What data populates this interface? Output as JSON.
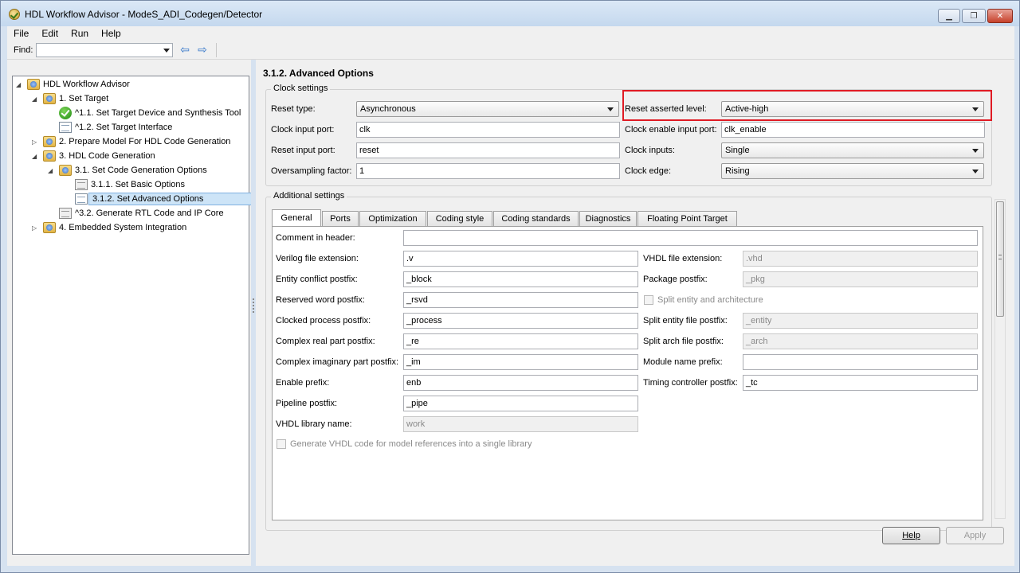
{
  "window": {
    "title": "HDL Workflow Advisor - ModeS_ADI_Codegen/Detector",
    "minimize": "▁",
    "maximize": "❐",
    "close": "✕"
  },
  "menu": [
    "File",
    "Edit",
    "Run",
    "Help"
  ],
  "toolbar": {
    "find_label": "Find:",
    "find_value": "",
    "back": "⇦",
    "forward": "⇨"
  },
  "tree": [
    {
      "label": "HDL Workflow Advisor",
      "level": 0,
      "expander": "◢",
      "icon": "folder-icon"
    },
    {
      "label": "1. Set Target",
      "level": 1,
      "expander": "◢",
      "icon": "folder-icon"
    },
    {
      "label": "^1.1. Set Target Device and Synthesis Tool",
      "level": 2,
      "expander": "",
      "icon": "check-icon"
    },
    {
      "label": "^1.2. Set Target Interface",
      "level": 2,
      "expander": "",
      "icon": "task-icon"
    },
    {
      "label": "2. Prepare Model For HDL Code Generation",
      "level": 1,
      "expander": "▷",
      "icon": "folder-icon"
    },
    {
      "label": "3. HDL Code Generation",
      "level": 1,
      "expander": "◢",
      "icon": "folder-icon"
    },
    {
      "label": "3.1. Set Code Generation Options",
      "level": 2,
      "expander": "◢",
      "icon": "folder-icon"
    },
    {
      "label": "3.1.1. Set Basic Options",
      "level": 3,
      "expander": "",
      "icon": "task-icon"
    },
    {
      "label": "3.1.2. Set Advanced Options",
      "level": 3,
      "expander": "",
      "icon": "task-icon",
      "selected": true
    },
    {
      "label": "^3.2. Generate RTL Code and IP Core",
      "level": 2,
      "expander": "",
      "icon": "task-icon"
    },
    {
      "label": "4. Embedded System Integration",
      "level": 1,
      "expander": "▷",
      "icon": "folder-icon"
    }
  ],
  "page_title": "3.1.2. Advanced Options",
  "clock_settings": {
    "title": "Clock settings",
    "reset_type_label": "Reset type:",
    "reset_type_value": "Asynchronous",
    "reset_level_label": "Reset asserted level:",
    "reset_level_value": "Active-high",
    "clock_input_port_label": "Clock input port:",
    "clock_input_port_value": "clk",
    "clock_enable_label": "Clock enable input port:",
    "clock_enable_value": "clk_enable",
    "reset_input_port_label": "Reset input port:",
    "reset_input_port_value": "reset",
    "clock_inputs_label": "Clock inputs:",
    "clock_inputs_value": "Single",
    "oversampling_label": "Oversampling factor:",
    "oversampling_value": "1",
    "clock_edge_label": "Clock edge:",
    "clock_edge_value": "Rising"
  },
  "additional_settings": {
    "title": "Additional settings",
    "tabs": [
      "General",
      "Ports",
      "Optimization",
      "Coding style",
      "Coding standards",
      "Diagnostics",
      "Floating Point Target"
    ],
    "active_tab": "General",
    "comment_label": "Comment in header:",
    "comment_value": "",
    "verilog_ext_label": "Verilog file extension:",
    "verilog_ext_value": ".v",
    "vhdl_ext_label": "VHDL file extension:",
    "vhdl_ext_value": ".vhd",
    "entity_conflict_label": "Entity conflict postfix:",
    "entity_conflict_value": "_block",
    "package_postfix_label": "Package postfix:",
    "package_postfix_value": "_pkg",
    "reserved_word_label": "Reserved word postfix:",
    "reserved_word_value": "_rsvd",
    "split_entity_arch_label": "Split entity and architecture",
    "clocked_process_label": "Clocked process postfix:",
    "clocked_process_value": "_process",
    "split_entity_file_label": "Split entity file postfix:",
    "split_entity_file_value": "_entity",
    "complex_real_label": "Complex real part postfix:",
    "complex_real_value": "_re",
    "split_arch_file_label": "Split arch file postfix:",
    "split_arch_file_value": "_arch",
    "complex_imag_label": "Complex imaginary part postfix:",
    "complex_imag_value": "_im",
    "module_name_prefix_label": "Module name prefix:",
    "module_name_prefix_value": "",
    "enable_prefix_label": "Enable prefix:",
    "enable_prefix_value": "enb",
    "timing_controller_label": "Timing controller postfix:",
    "timing_controller_value": "_tc",
    "pipeline_postfix_label": "Pipeline postfix:",
    "pipeline_postfix_value": "_pipe",
    "vhdl_library_label": "VHDL library name:",
    "vhdl_library_value": "work",
    "single_library_label": "Generate VHDL code for model references into a single library"
  },
  "buttons": {
    "help": "Help",
    "apply": "Apply"
  },
  "colors": {
    "highlight": "#e01b24",
    "selection": "#cde4f7"
  }
}
